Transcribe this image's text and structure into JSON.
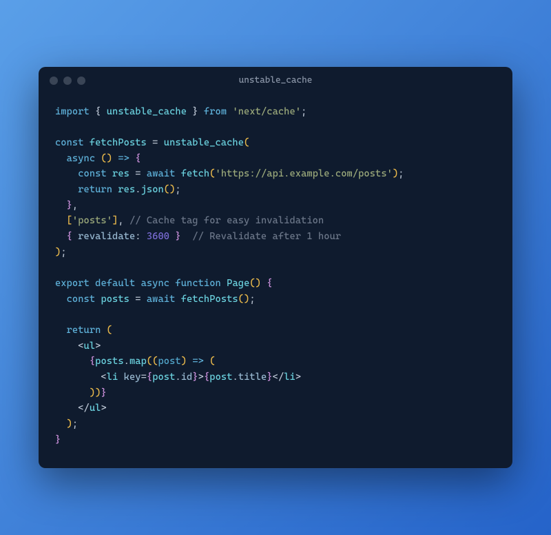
{
  "window": {
    "title": "unstable_cache"
  },
  "code": {
    "tokens": [
      [
        {
          "t": "import",
          "c": "kw"
        },
        {
          "t": " { ",
          "c": "punc"
        },
        {
          "t": "unstable_cache",
          "c": "fn"
        },
        {
          "t": " } ",
          "c": "punc"
        },
        {
          "t": "from",
          "c": "kw"
        },
        {
          "t": " ",
          "c": ""
        },
        {
          "t": "'next/cache'",
          "c": "str2"
        },
        {
          "t": ";",
          "c": "punc"
        }
      ],
      [],
      [
        {
          "t": "const",
          "c": "kw"
        },
        {
          "t": " ",
          "c": ""
        },
        {
          "t": "fetchPosts",
          "c": "fn"
        },
        {
          "t": " = ",
          "c": "punc"
        },
        {
          "t": "unstable_cache",
          "c": "fn"
        },
        {
          "t": "(",
          "c": "paren"
        }
      ],
      [
        {
          "t": "  ",
          "c": ""
        },
        {
          "t": "async",
          "c": "kw"
        },
        {
          "t": " ",
          "c": ""
        },
        {
          "t": "()",
          "c": "paren"
        },
        {
          "t": " ",
          "c": ""
        },
        {
          "t": "=>",
          "c": "kw"
        },
        {
          "t": " ",
          "c": ""
        },
        {
          "t": "{",
          "c": "brace"
        }
      ],
      [
        {
          "t": "    ",
          "c": ""
        },
        {
          "t": "const",
          "c": "kw"
        },
        {
          "t": " ",
          "c": ""
        },
        {
          "t": "res",
          "c": "fn"
        },
        {
          "t": " = ",
          "c": "punc"
        },
        {
          "t": "await",
          "c": "kw"
        },
        {
          "t": " ",
          "c": ""
        },
        {
          "t": "fetch",
          "c": "fn"
        },
        {
          "t": "(",
          "c": "paren"
        },
        {
          "t": "'https://api.example.com/posts'",
          "c": "str2"
        },
        {
          "t": ")",
          "c": "paren"
        },
        {
          "t": ";",
          "c": "punc"
        }
      ],
      [
        {
          "t": "    ",
          "c": ""
        },
        {
          "t": "return",
          "c": "kw"
        },
        {
          "t": " ",
          "c": ""
        },
        {
          "t": "res",
          "c": "fn"
        },
        {
          "t": ".",
          "c": "punc"
        },
        {
          "t": "json",
          "c": "fn"
        },
        {
          "t": "()",
          "c": "paren"
        },
        {
          "t": ";",
          "c": "punc"
        }
      ],
      [
        {
          "t": "  ",
          "c": ""
        },
        {
          "t": "}",
          "c": "brace"
        },
        {
          "t": ",",
          "c": "punc"
        }
      ],
      [
        {
          "t": "  ",
          "c": ""
        },
        {
          "t": "[",
          "c": "paren"
        },
        {
          "t": "'posts'",
          "c": "str2"
        },
        {
          "t": "]",
          "c": "paren"
        },
        {
          "t": ", ",
          "c": "punc"
        },
        {
          "t": "// Cache tag for easy invalidation",
          "c": "cmt"
        }
      ],
      [
        {
          "t": "  ",
          "c": ""
        },
        {
          "t": "{ ",
          "c": "brace"
        },
        {
          "t": "revalidate",
          "c": "prop"
        },
        {
          "t": ": ",
          "c": "punc"
        },
        {
          "t": "3600",
          "c": "num"
        },
        {
          "t": " }",
          "c": "brace"
        },
        {
          "t": "  ",
          "c": ""
        },
        {
          "t": "// Revalidate after 1 hour",
          "c": "cmt"
        }
      ],
      [
        {
          "t": ")",
          "c": "paren"
        },
        {
          "t": ";",
          "c": "punc"
        }
      ],
      [],
      [
        {
          "t": "export",
          "c": "kw"
        },
        {
          "t": " ",
          "c": ""
        },
        {
          "t": "default",
          "c": "kw"
        },
        {
          "t": " ",
          "c": ""
        },
        {
          "t": "async",
          "c": "kw"
        },
        {
          "t": " ",
          "c": ""
        },
        {
          "t": "function",
          "c": "kw"
        },
        {
          "t": " ",
          "c": ""
        },
        {
          "t": "Page",
          "c": "fn"
        },
        {
          "t": "()",
          "c": "paren"
        },
        {
          "t": " ",
          "c": ""
        },
        {
          "t": "{",
          "c": "brace"
        }
      ],
      [
        {
          "t": "  ",
          "c": ""
        },
        {
          "t": "const",
          "c": "kw"
        },
        {
          "t": " ",
          "c": ""
        },
        {
          "t": "posts",
          "c": "fn"
        },
        {
          "t": " = ",
          "c": "punc"
        },
        {
          "t": "await",
          "c": "kw"
        },
        {
          "t": " ",
          "c": ""
        },
        {
          "t": "fetchPosts",
          "c": "fn"
        },
        {
          "t": "()",
          "c": "paren"
        },
        {
          "t": ";",
          "c": "punc"
        }
      ],
      [],
      [
        {
          "t": "  ",
          "c": ""
        },
        {
          "t": "return",
          "c": "kw"
        },
        {
          "t": " ",
          "c": ""
        },
        {
          "t": "(",
          "c": "paren"
        }
      ],
      [
        {
          "t": "    <",
          "c": "punc"
        },
        {
          "t": "ul",
          "c": "tag"
        },
        {
          "t": ">",
          "c": "punc"
        }
      ],
      [
        {
          "t": "      ",
          "c": ""
        },
        {
          "t": "{",
          "c": "brace"
        },
        {
          "t": "posts",
          "c": "fn"
        },
        {
          "t": ".",
          "c": "punc"
        },
        {
          "t": "map",
          "c": "fn"
        },
        {
          "t": "((",
          "c": "paren"
        },
        {
          "t": "post",
          "c": "var"
        },
        {
          "t": ")",
          "c": "paren"
        },
        {
          "t": " ",
          "c": ""
        },
        {
          "t": "=>",
          "c": "kw"
        },
        {
          "t": " ",
          "c": ""
        },
        {
          "t": "(",
          "c": "paren"
        }
      ],
      [
        {
          "t": "        <",
          "c": "punc"
        },
        {
          "t": "li",
          "c": "tag"
        },
        {
          "t": " ",
          "c": ""
        },
        {
          "t": "key",
          "c": "prop"
        },
        {
          "t": "=",
          "c": "punc"
        },
        {
          "t": "{",
          "c": "brace"
        },
        {
          "t": "post",
          "c": "fn"
        },
        {
          "t": ".",
          "c": "punc"
        },
        {
          "t": "id",
          "c": "prop"
        },
        {
          "t": "}",
          "c": "brace"
        },
        {
          "t": ">",
          "c": "punc"
        },
        {
          "t": "{",
          "c": "brace"
        },
        {
          "t": "post",
          "c": "fn"
        },
        {
          "t": ".",
          "c": "punc"
        },
        {
          "t": "title",
          "c": "prop"
        },
        {
          "t": "}",
          "c": "brace"
        },
        {
          "t": "</",
          "c": "punc"
        },
        {
          "t": "li",
          "c": "tag"
        },
        {
          "t": ">",
          "c": "punc"
        }
      ],
      [
        {
          "t": "      ",
          "c": ""
        },
        {
          "t": "))",
          "c": "paren"
        },
        {
          "t": "}",
          "c": "brace"
        }
      ],
      [
        {
          "t": "    </",
          "c": "punc"
        },
        {
          "t": "ul",
          "c": "tag"
        },
        {
          "t": ">",
          "c": "punc"
        }
      ],
      [
        {
          "t": "  ",
          "c": ""
        },
        {
          "t": ")",
          "c": "paren"
        },
        {
          "t": ";",
          "c": "punc"
        }
      ],
      [
        {
          "t": "}",
          "c": "brace"
        }
      ]
    ]
  }
}
